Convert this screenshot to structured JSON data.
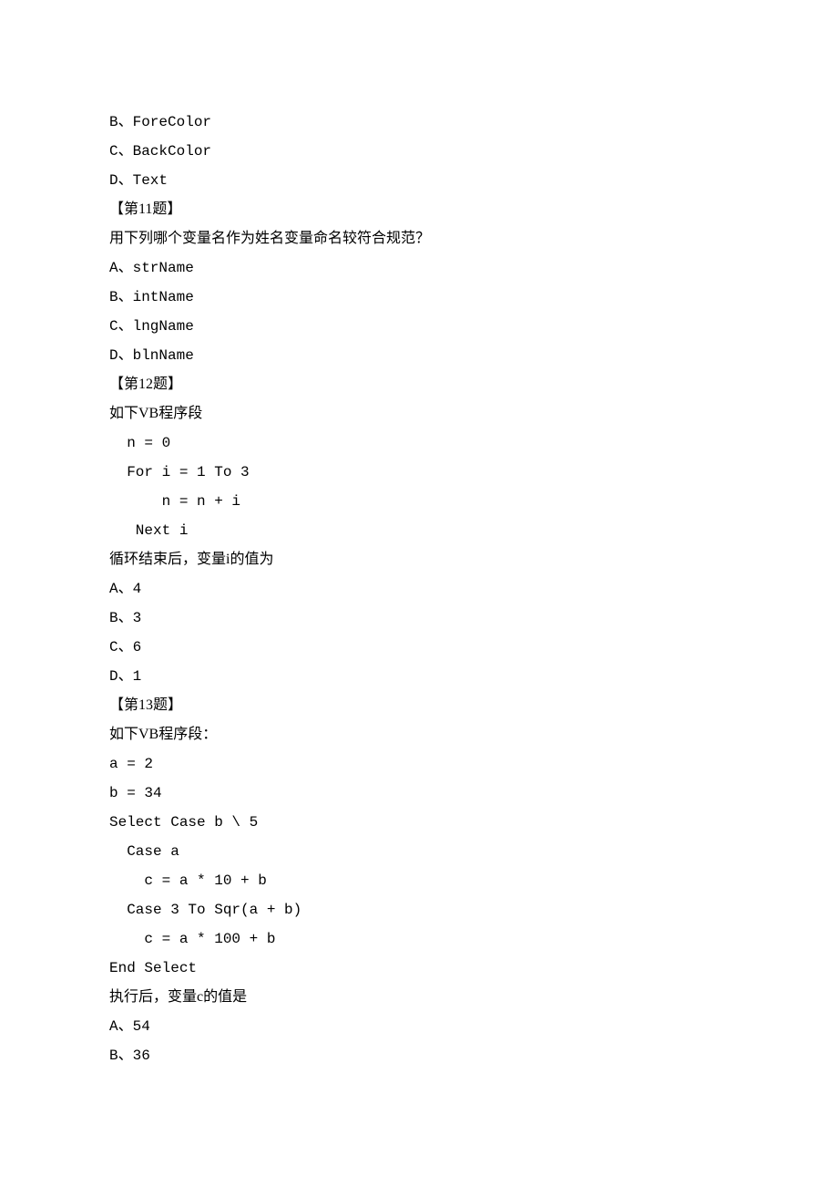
{
  "lines": [
    {
      "text": "B、ForeColor",
      "cls": "mono"
    },
    {
      "text": "C、BackColor",
      "cls": "mono"
    },
    {
      "text": "D、Text",
      "cls": "mono"
    },
    {
      "text": "【第11题】",
      "cls": ""
    },
    {
      "text": "用下列哪个变量名作为姓名变量命名较符合规范？",
      "cls": ""
    },
    {
      "text": "A、strName",
      "cls": "mono"
    },
    {
      "text": "B、intName",
      "cls": "mono"
    },
    {
      "text": "C、lngName",
      "cls": "mono"
    },
    {
      "text": "D、blnName",
      "cls": "mono"
    },
    {
      "text": "【第12题】",
      "cls": ""
    },
    {
      "text": "如下VB程序段",
      "cls": ""
    },
    {
      "text": "  n = 0",
      "cls": "mono"
    },
    {
      "text": "  For i = 1 To 3",
      "cls": "mono"
    },
    {
      "text": "      n = n + i",
      "cls": "mono"
    },
    {
      "text": "   Next i",
      "cls": "mono"
    },
    {
      "text": "循环结束后，变量i的值为",
      "cls": ""
    },
    {
      "text": "A、4",
      "cls": "mono"
    },
    {
      "text": "B、3",
      "cls": "mono"
    },
    {
      "text": "C、6",
      "cls": "mono"
    },
    {
      "text": "D、1",
      "cls": "mono"
    },
    {
      "text": "【第13题】",
      "cls": ""
    },
    {
      "text": "如下VB程序段：",
      "cls": ""
    },
    {
      "text": "a = 2",
      "cls": "mono"
    },
    {
      "text": "b = 34",
      "cls": "mono"
    },
    {
      "text": "Select Case b \\ 5",
      "cls": "mono"
    },
    {
      "text": "  Case a",
      "cls": "mono"
    },
    {
      "text": "    c = a * 10 + b",
      "cls": "mono"
    },
    {
      "text": "  Case 3 To Sqr(a + b)",
      "cls": "mono"
    },
    {
      "text": "    c = a * 100 + b",
      "cls": "mono"
    },
    {
      "text": "End Select",
      "cls": "mono"
    },
    {
      "text": "执行后，变量c的值是",
      "cls": ""
    },
    {
      "text": "A、54",
      "cls": "mono"
    },
    {
      "text": "B、36",
      "cls": "mono"
    }
  ]
}
